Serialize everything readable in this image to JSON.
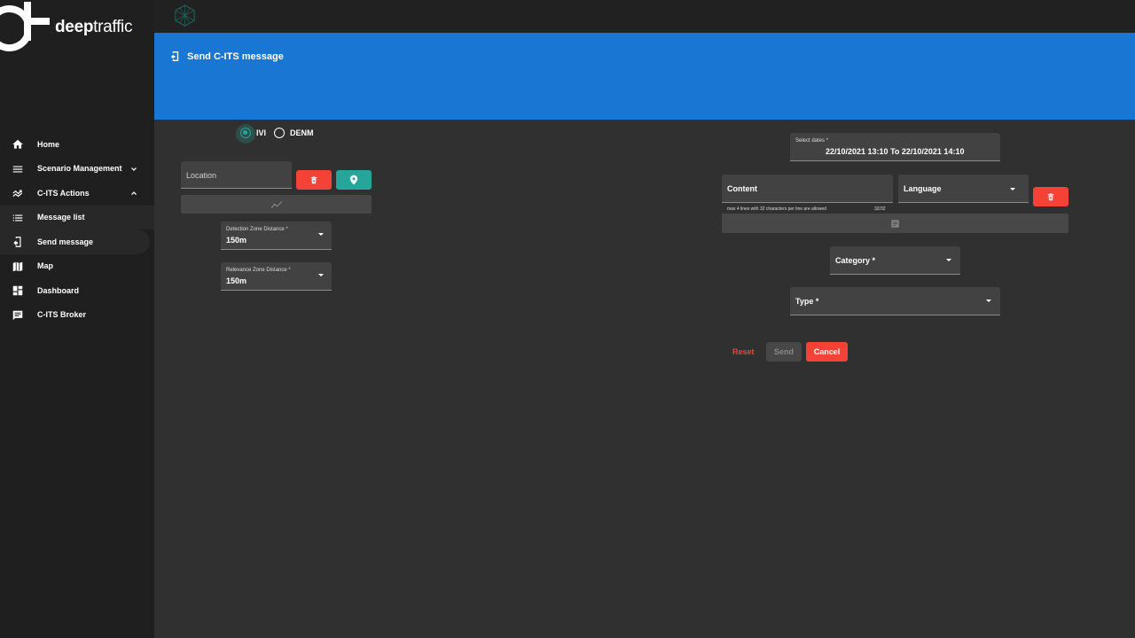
{
  "app": {
    "logo_text_bold": "deep",
    "logo_text_light": "traffic"
  },
  "sidebar": {
    "items": [
      {
        "label": "Home",
        "icon": "home-icon"
      },
      {
        "label": "Scenario Management",
        "icon": "menu-icon"
      },
      {
        "label": "C-ITS Actions",
        "icon": "trending-icon"
      },
      {
        "label": "Message list",
        "icon": "list-icon"
      },
      {
        "label": "Send message",
        "icon": "send-icon"
      },
      {
        "label": "Map",
        "icon": "map-icon"
      },
      {
        "label": "Dashboard",
        "icon": "dashboard-icon"
      },
      {
        "label": "C-ITS Broker",
        "icon": "chat-icon"
      }
    ]
  },
  "header": {
    "title": "Send C-ITS message"
  },
  "message_type": {
    "options": [
      "IVI",
      "DENM"
    ],
    "selected": "IVI"
  },
  "location": {
    "label": "Location"
  },
  "detection_zone": {
    "label": "Detection Zone Distance *",
    "value": "150m"
  },
  "relevance_zone": {
    "label": "Relevance Zone Distance *",
    "value": "150m"
  },
  "dates": {
    "label": "Select dates *",
    "value": "22/10/2021 13:10 To 22/10/2021 14:10"
  },
  "content": {
    "label": "Content",
    "hint": "max 4 lines with 32 characters per line are allowed",
    "counter": "32/32"
  },
  "language": {
    "label": "Language"
  },
  "category": {
    "label": "Category *"
  },
  "type": {
    "label": "Type *"
  },
  "actions": {
    "reset": "Reset",
    "send": "Send",
    "cancel": "Cancel"
  },
  "colors": {
    "accent": "#1976d2",
    "danger": "#f44336",
    "teal": "#26a69a"
  }
}
